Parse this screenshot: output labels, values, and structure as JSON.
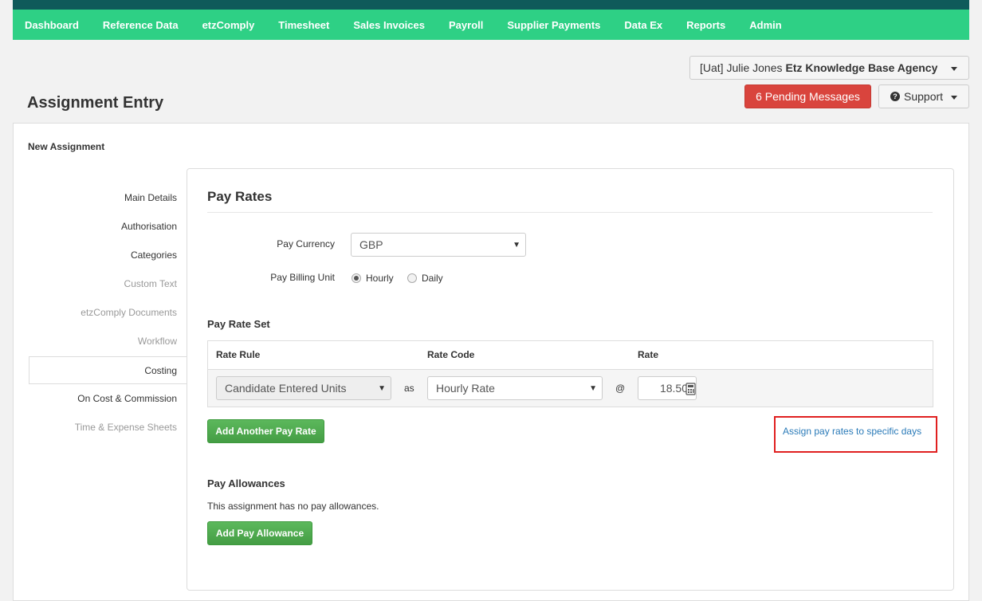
{
  "nav": {
    "items": [
      "Dashboard",
      "Reference Data",
      "etzComply",
      "Timesheet",
      "Sales Invoices",
      "Payroll",
      "Supplier Payments",
      "Data Ex",
      "Reports",
      "Admin"
    ]
  },
  "user": {
    "prefix": "[Uat] Julie Jones",
    "agency": "Etz Knowledge Base Agency"
  },
  "header": {
    "pending_messages": "6 Pending Messages",
    "support": "Support",
    "page_title": "Assignment Entry"
  },
  "section_label": "New Assignment",
  "sidebar": {
    "items": [
      {
        "label": "Main Details",
        "state": "enabled"
      },
      {
        "label": "Authorisation",
        "state": "enabled"
      },
      {
        "label": "Categories",
        "state": "enabled"
      },
      {
        "label": "Custom Text",
        "state": "disabled"
      },
      {
        "label": "etzComply Documents",
        "state": "disabled"
      },
      {
        "label": "Workflow",
        "state": "disabled"
      },
      {
        "label": "Costing",
        "state": "active"
      },
      {
        "label": "On Cost & Commission",
        "state": "enabled"
      },
      {
        "label": "Time & Expense Sheets",
        "state": "disabled"
      }
    ]
  },
  "pay_rates": {
    "heading": "Pay Rates",
    "currency_label": "Pay Currency",
    "currency_value": "GBP",
    "billing_unit_label": "Pay Billing Unit",
    "billing_options": [
      {
        "label": "Hourly",
        "checked": true
      },
      {
        "label": "Daily",
        "checked": false
      }
    ]
  },
  "rate_set": {
    "heading": "Pay Rate Set",
    "columns": [
      "Rate Rule",
      "Rate Code",
      "Rate"
    ],
    "row": {
      "rule": "Candidate Entered Units",
      "as": "as",
      "code": "Hourly Rate",
      "at": "@",
      "rate": "18.50"
    },
    "add_button": "Add Another Pay Rate",
    "assign_link": "Assign pay rates to specific days"
  },
  "allowances": {
    "heading": "Pay Allowances",
    "empty_text": "This assignment has no pay allowances.",
    "add_button": "Add Pay Allowance"
  }
}
